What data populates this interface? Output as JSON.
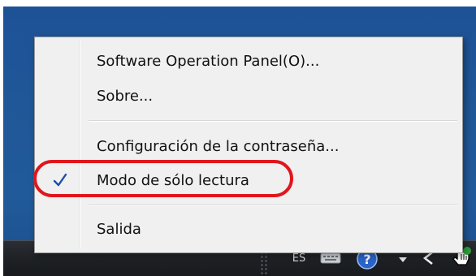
{
  "context_menu": {
    "items": [
      {
        "label": "Software Operation Panel(O)...",
        "checked": false
      },
      {
        "label": "Sobre...",
        "checked": false
      },
      {
        "label": "Configuración de la contraseña...",
        "checked": false
      },
      {
        "label": "Modo de sólo lectura",
        "checked": true
      },
      {
        "label": "Salida",
        "checked": false
      }
    ]
  },
  "taskbar": {
    "language": "ES"
  },
  "colors": {
    "desktop": "#1f5798",
    "menu_background": "#f0f0f0",
    "check": "#1a4fa8",
    "highlight": "#e0161c"
  },
  "icons": [
    "check-icon",
    "keyboard-icon",
    "help-icon",
    "tray-overflow-icon",
    "back-arrow-icon",
    "scanner-app-icon"
  ]
}
